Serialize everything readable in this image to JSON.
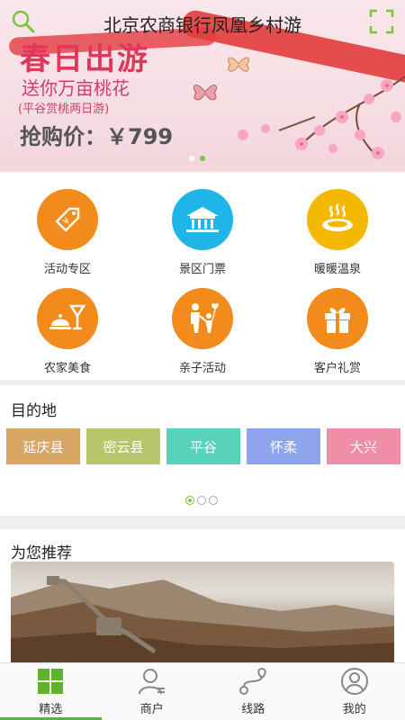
{
  "header": {
    "title": "北京农商银行凤凰乡村游"
  },
  "banner": {
    "title": "春日出游",
    "subtitle": "送你万亩桃花",
    "note": "(平谷赏桃两日游)",
    "price": "抢购价：￥799",
    "active_dot": 2,
    "dot_count": 2
  },
  "categories": [
    {
      "label": "活动专区",
      "icon": "price-tag-icon",
      "color": "#f38a1c"
    },
    {
      "label": "景区门票",
      "icon": "scenic-temple-icon",
      "color": "#1fb5e8"
    },
    {
      "label": "暖暖温泉",
      "icon": "hot-spring-icon",
      "color": "#f5b800"
    },
    {
      "label": "农家美食",
      "icon": "food-cloche-icon",
      "color": "#f38a1c"
    },
    {
      "label": "亲子活动",
      "icon": "parent-child-icon",
      "color": "#f38a1c"
    },
    {
      "label": "客户礼赏",
      "icon": "gift-icon",
      "color": "#f38a1c"
    }
  ],
  "destinations": {
    "heading": "目的地",
    "items": [
      {
        "label": "延庆县",
        "color": "#d9a565"
      },
      {
        "label": "密云县",
        "color": "#b8c56a"
      },
      {
        "label": "平谷",
        "color": "#58d1b9"
      },
      {
        "label": "怀柔",
        "color": "#8ea5ee"
      },
      {
        "label": "大兴",
        "color": "#ef8fa7"
      }
    ],
    "page_active": 1,
    "page_count": 3
  },
  "recommend": {
    "heading": "为您推荐"
  },
  "tabbar": {
    "items": [
      {
        "label": "精选",
        "icon": "grid-icon",
        "active": true
      },
      {
        "label": "商户",
        "icon": "merchant-user-icon",
        "active": false
      },
      {
        "label": "线路",
        "icon": "route-icon",
        "active": false
      },
      {
        "label": "我的",
        "icon": "profile-icon",
        "active": false
      }
    ]
  }
}
